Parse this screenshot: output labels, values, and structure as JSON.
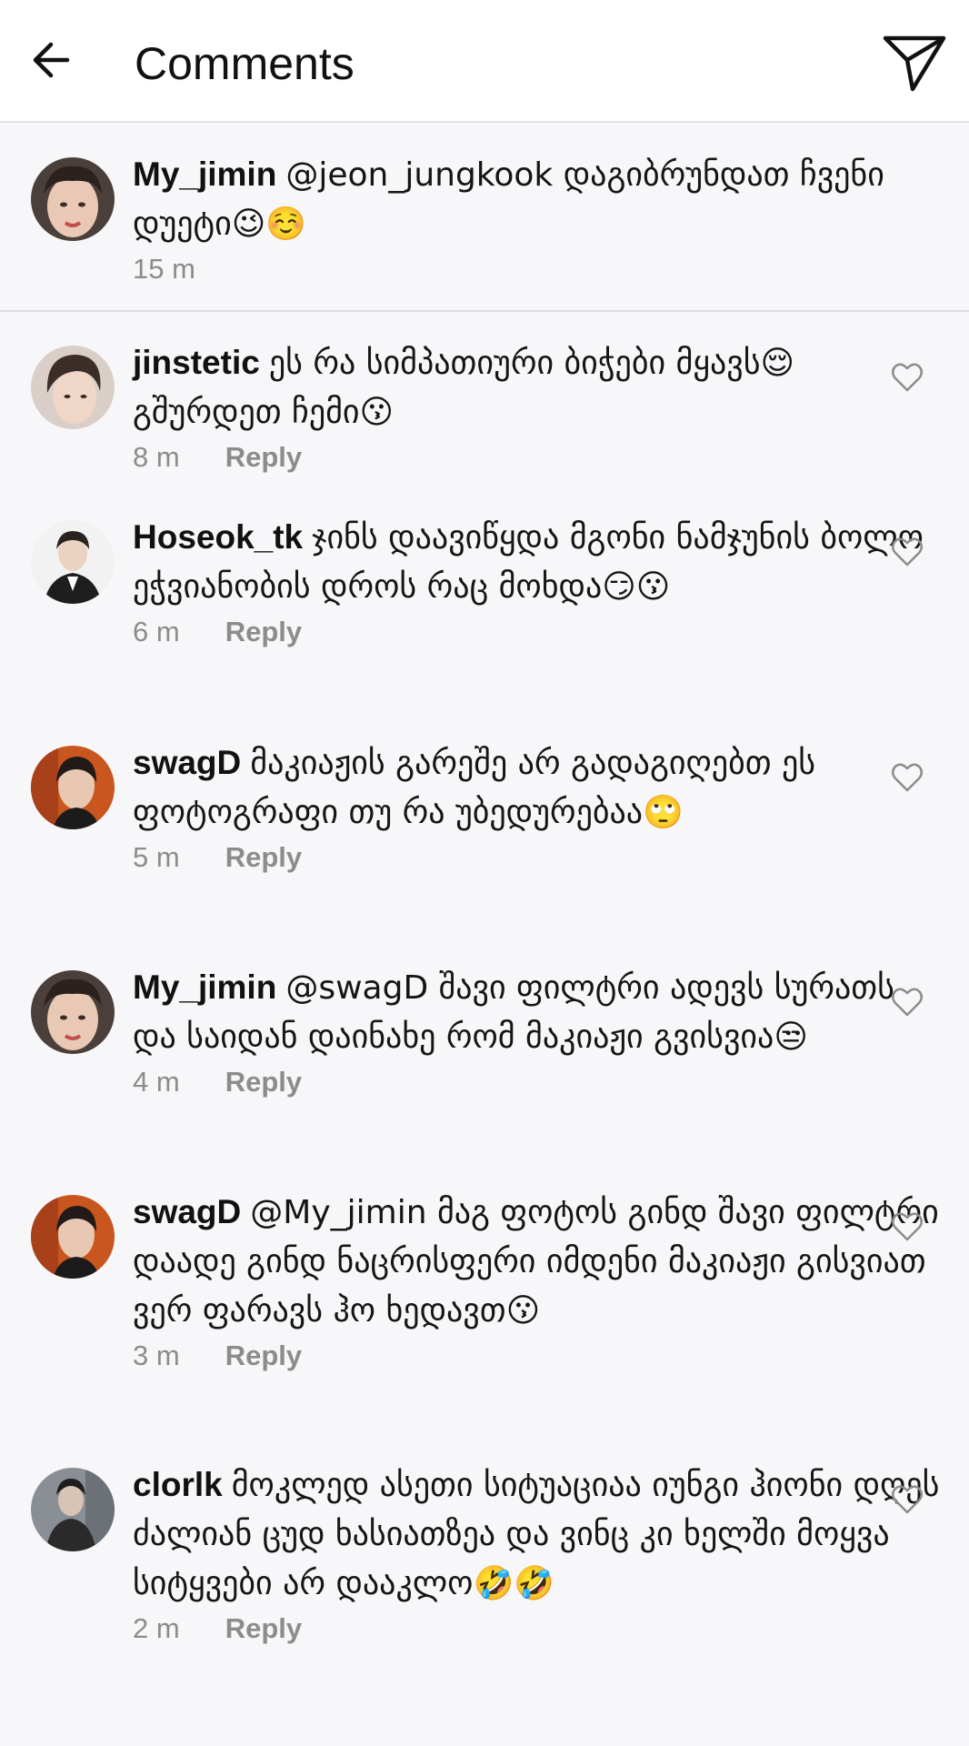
{
  "header": {
    "title": "Comments",
    "back_icon": "arrow-left-icon",
    "send_icon": "paper-plane-icon"
  },
  "caption": {
    "username": "My_jimin",
    "text": "@jeon_jungkook დაგიბრუნდათ ჩვენი დუეტი😉☺️",
    "time": "15 m"
  },
  "comments": [
    {
      "username": "jinstetic",
      "text": "ეს რა სიმპათიური ბიჭები მყავს😌 გშურდეთ ჩემი😗",
      "time": "8 m",
      "reply": "Reply"
    },
    {
      "username": "Hoseok_tk",
      "text": "ჯინს დაავიწყდა მგონი ნამჯუნის ბოლო ეჭვიანობის დროს რაც მოხდა😏😗",
      "time": "6 m",
      "reply": "Reply"
    },
    {
      "username": "swagD",
      "text": "მაკიაჟის გარეშე არ გადაგიღებთ ეს ფოტოგრაფი თუ რა უბედურებაა🙄",
      "time": "5 m",
      "reply": "Reply"
    },
    {
      "username": "My_jimin",
      "text": "@swagD შავი ფილტრი ადევს სურათს და საიდან დაინახე რომ მაკიაჟი გვისვია😒",
      "time": "4 m",
      "reply": "Reply"
    },
    {
      "username": "swagD",
      "text": "@My_jimin მაგ ფოტოს გინდ შავი ფილტრი დაადე გინდ ნაცრისფერი იმდენი მაკიაჟი გისვიათ ვერ ფარავს ჰო ხედავთ😗",
      "time": "3 m",
      "reply": "Reply"
    },
    {
      "username": "clorlk",
      "text": "მოკლედ ასეთი სიტუაციაა იუნგი ჰიონი დღეს ძალიან ცუდ ხასიათზეა და ვინც კი ხელში მოყვა სიტყვები არ დააკლო🤣🤣",
      "time": "2 m",
      "reply": "Reply"
    }
  ],
  "colors": {
    "background": "#f7f7fa",
    "header_bg": "#ffffff",
    "meta_text": "#8c8c8c",
    "primary_text": "#111111"
  }
}
